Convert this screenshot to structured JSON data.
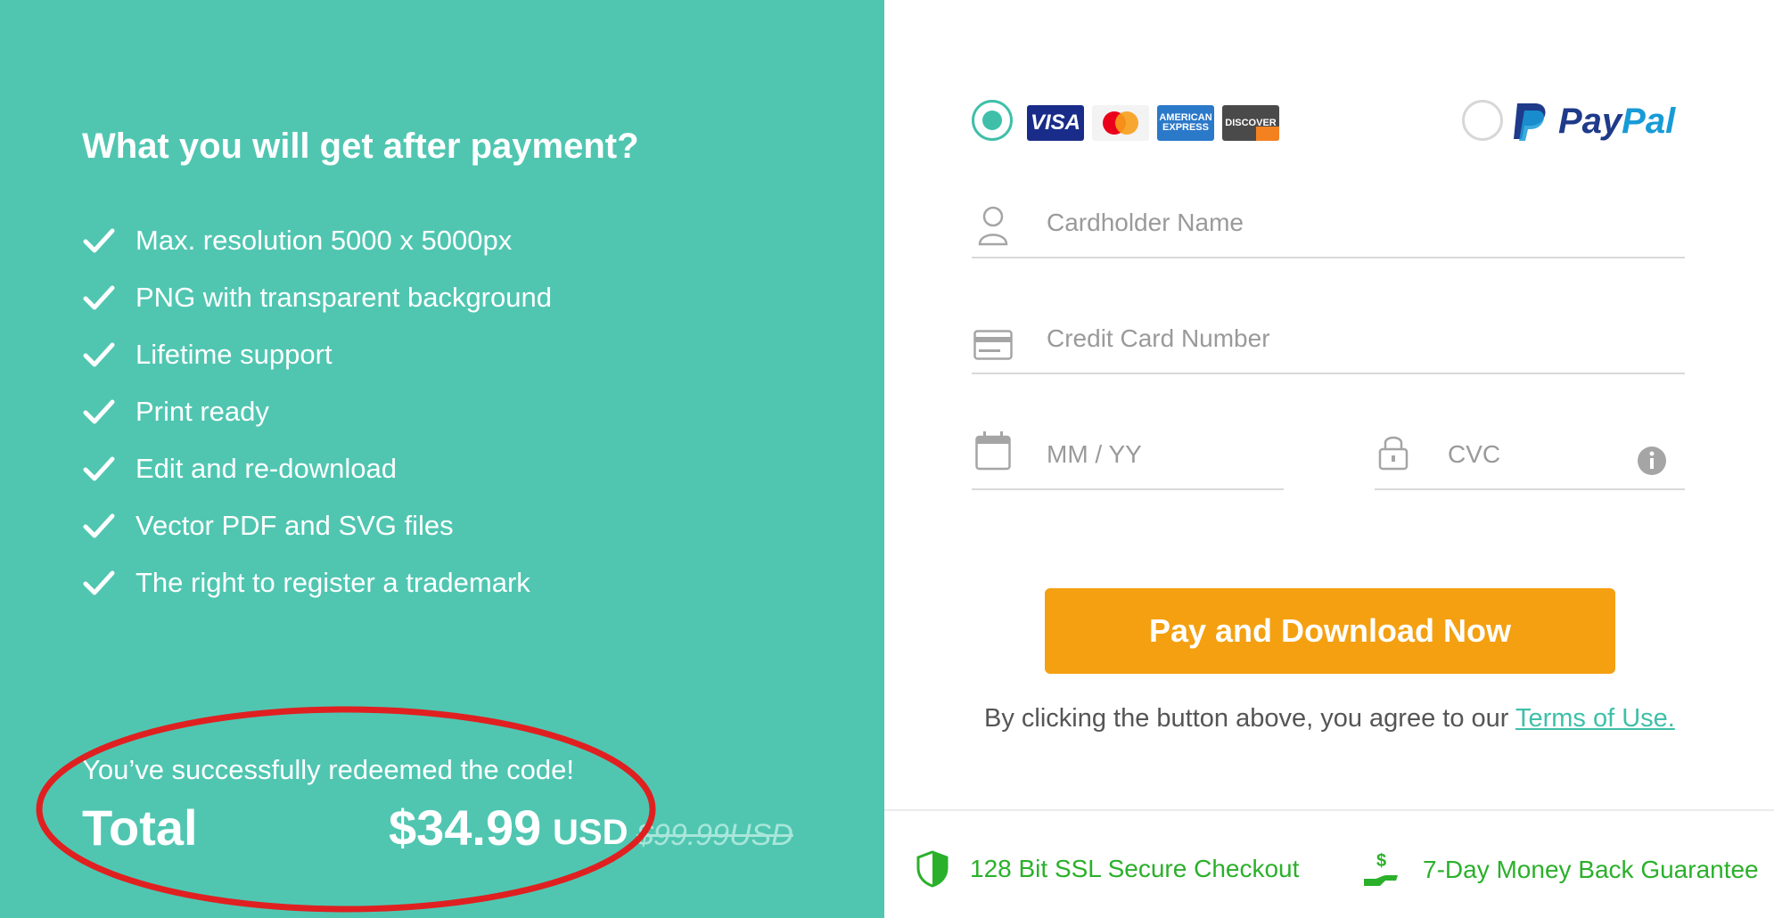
{
  "left": {
    "heading": "What you will get after payment?",
    "features": [
      "Max. resolution 5000 x 5000px",
      "PNG with transparent background",
      "Lifetime support",
      "Print ready",
      "Edit and re-download",
      "Vector PDF and SVG files",
      "The right to register a trademark"
    ],
    "redeem_message": "You’ve successfully redeemed the code!",
    "total_label": "Total",
    "price": "$34.99",
    "currency": "USD",
    "old_price": "$99.99USD"
  },
  "payment": {
    "card_logos": {
      "visa": "VISA",
      "amex": "AMERICAN EXPRESS",
      "discover": "DISCOVER"
    },
    "paypal": {
      "pay": "Pay",
      "pal": "Pal"
    },
    "cardholder_placeholder": "Cardholder Name",
    "card_number_placeholder": "Credit Card Number",
    "expiry_placeholder": "MM / YY",
    "cvc_placeholder": "CVC",
    "pay_button": "Pay and Download Now",
    "agree_text": "By clicking the button above, you agree to our ",
    "terms_link": "Terms of Use."
  },
  "footer": {
    "ssl": "128 Bit SSL Secure Checkout",
    "guarantee": "7-Day Money Back Guarantee"
  },
  "colors": {
    "left_bg": "#50c6b1",
    "accent": "#3fbfa9",
    "button": "#f4a011",
    "footer_green": "#2bb02b",
    "highlight_ring": "#e02020"
  }
}
